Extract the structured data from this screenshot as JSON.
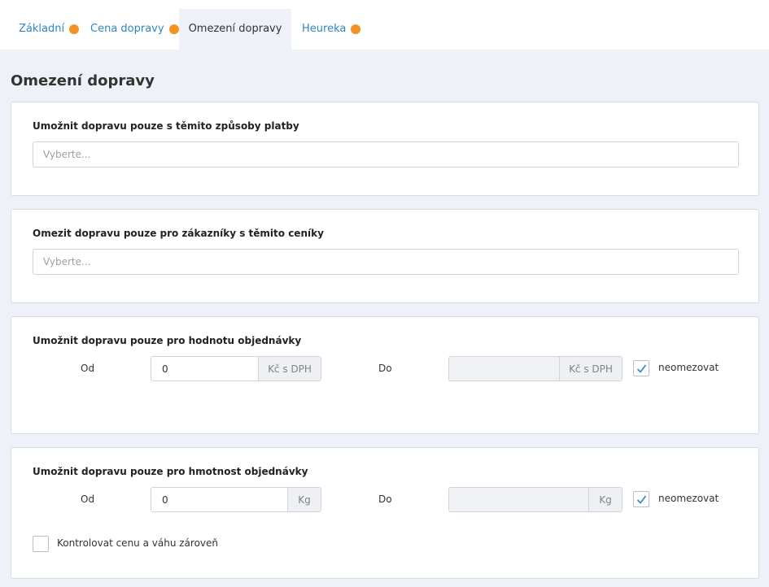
{
  "tabs": [
    {
      "label": "Základní",
      "has_indicator": true
    },
    {
      "label": "Cena dopravy",
      "has_indicator": true
    },
    {
      "label": "Omezení dopravy",
      "has_indicator": false,
      "active": true
    },
    {
      "label": "Heureka",
      "has_indicator": true
    }
  ],
  "page_title": "Omezení dopravy",
  "payment_section": {
    "title": "Umožnit dopravu pouze s těmito způsoby platby",
    "placeholder": "Vyberte..."
  },
  "pricelist_section": {
    "title": "Omezit dopravu pouze pro zákazníky s těmito ceníky",
    "placeholder": "Vyberte..."
  },
  "value_section": {
    "title": "Umožnit dopravu pouze pro hodnotu objednávky",
    "from_label": "Od",
    "from_value": "0",
    "from_unit": "Kč s DPH",
    "to_label": "Do",
    "to_value": "",
    "to_unit": "Kč s DPH",
    "unlimited_label": "neomezovat",
    "unlimited_checked": true
  },
  "weight_section": {
    "title": "Umožnit dopravu pouze pro hmotnost objednávky",
    "from_label": "Od",
    "from_value": "0",
    "from_unit": "Kg",
    "to_label": "Do",
    "to_value": "",
    "to_unit": "Kg",
    "unlimited_label": "neomezovat",
    "unlimited_checked": true,
    "combined_label": "Kontrolovat cenu a váhu zároveň",
    "combined_checked": false
  },
  "colors": {
    "accent": "#2e86c1",
    "indicator": "#f39323",
    "background": "#eef1f8"
  }
}
